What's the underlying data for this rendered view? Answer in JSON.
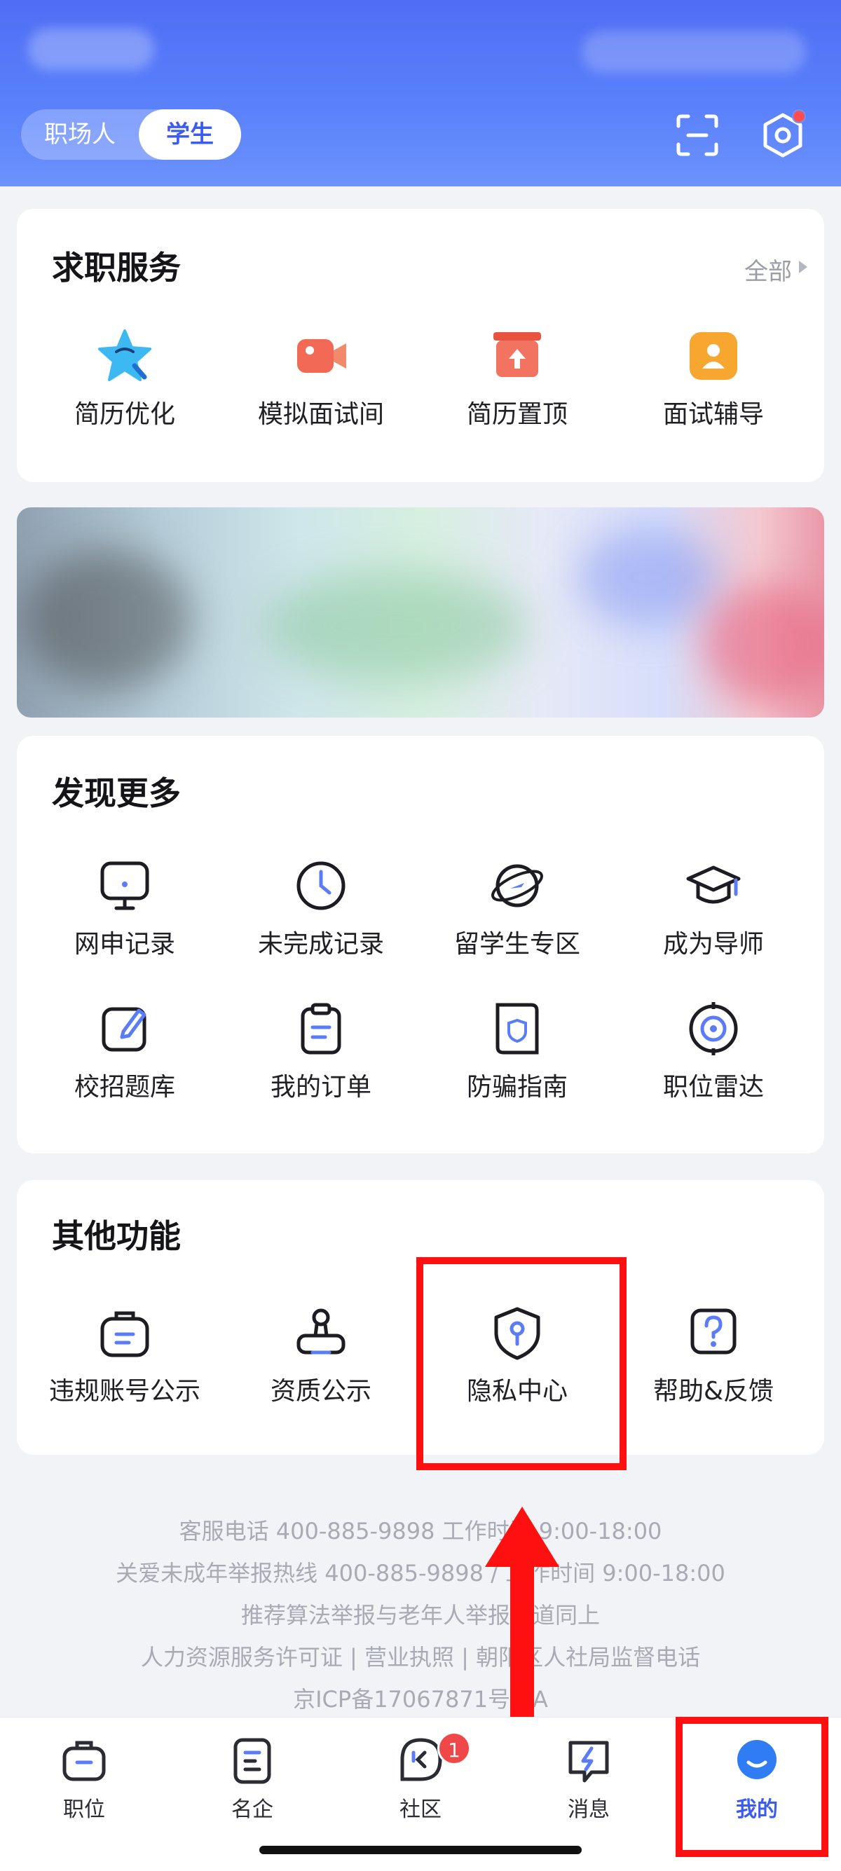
{
  "header": {
    "segments": [
      "职场人",
      "学生"
    ],
    "active_segment": "学生",
    "scan_icon": "scan-icon",
    "settings_icon": "settings-icon"
  },
  "job_services": {
    "title": "求职服务",
    "more_label": "全部",
    "items": [
      {
        "label": "简历优化",
        "icon": "star-resume-icon",
        "color": "#36b6f0"
      },
      {
        "label": "模拟面试间",
        "icon": "video-camera-icon",
        "color": "#f26a55"
      },
      {
        "label": "简历置顶",
        "icon": "pin-top-icon",
        "color": "#ee5e4c"
      },
      {
        "label": "面试辅导",
        "icon": "coach-icon",
        "color": "#f7a630"
      }
    ]
  },
  "discover": {
    "title": "发现更多",
    "items": [
      {
        "label": "网申记录",
        "icon": "monitor-icon"
      },
      {
        "label": "未完成记录",
        "icon": "clock-icon"
      },
      {
        "label": "留学生专区",
        "icon": "globe-plane-icon"
      },
      {
        "label": "成为导师",
        "icon": "graduation-cap-icon"
      },
      {
        "label": "校招题库",
        "icon": "edit-pencil-icon"
      },
      {
        "label": "我的订单",
        "icon": "clipboard-icon"
      },
      {
        "label": "防骗指南",
        "icon": "shield-book-icon"
      },
      {
        "label": "职位雷达",
        "icon": "radar-target-icon"
      }
    ]
  },
  "other": {
    "title": "其他功能",
    "items": [
      {
        "label": "违规账号公示",
        "icon": "bag-notice-icon"
      },
      {
        "label": "资质公示",
        "icon": "stamp-icon"
      },
      {
        "label": "隐私中心",
        "icon": "privacy-shield-icon"
      },
      {
        "label": "帮助&反馈",
        "icon": "help-question-icon"
      }
    ]
  },
  "footer": {
    "line1": "客服电话 400-885-9898  工作时间 9:00-18:00",
    "line2": "关爱未成年举报热线 400-885-9898 / 工作时间 9:00-18:00",
    "line3": "推荐算法举报与老年人举报渠道同上",
    "line4": "人力资源服务许可证  |  营业执照  |  朝阳区人社局监督电话",
    "line5": "京ICP备17067871号-1A"
  },
  "tabbar": {
    "items": [
      {
        "label": "职位",
        "icon": "briefcase-icon"
      },
      {
        "label": "名企",
        "icon": "company-icon"
      },
      {
        "label": "社区",
        "icon": "community-chat-icon",
        "badge": "1"
      },
      {
        "label": "消息",
        "icon": "message-bolt-icon"
      },
      {
        "label": "我的",
        "icon": "profile-avatar-icon"
      }
    ],
    "active": "我的"
  },
  "annotation_color": "#ff1010",
  "accent_color": "#3c5cf1"
}
